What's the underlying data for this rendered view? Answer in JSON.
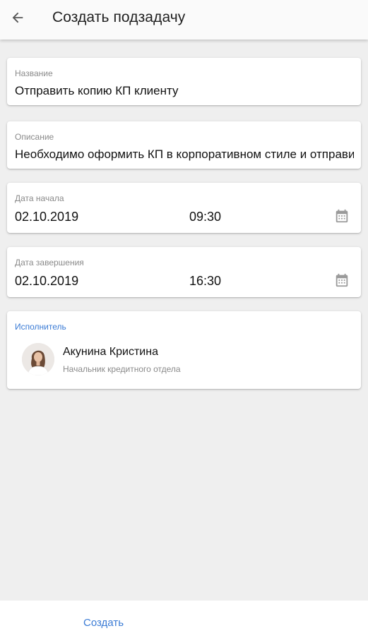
{
  "header": {
    "title": "Создать подзадачу",
    "back_icon": "arrow-left-icon"
  },
  "name_field": {
    "label": "Название",
    "value": "Отправить копию КП клиенту"
  },
  "description_field": {
    "label": "Описание",
    "value": "Необходимо оформить КП в корпоративном стиле и отправить клиенту"
  },
  "start_field": {
    "label": "Дата начала",
    "date": "02.10.2019",
    "time": "09:30",
    "icon": "calendar-icon"
  },
  "end_field": {
    "label": "Дата завершения",
    "date": "02.10.2019",
    "time": "16:30",
    "icon": "calendar-icon"
  },
  "assignee": {
    "label": "Исполнитель",
    "name": "Акунина Кристина",
    "role": "Начальник кредитного отдела"
  },
  "footer": {
    "create_label": "Создать"
  },
  "colors": {
    "accent": "#3a7bd5",
    "background": "#efefef"
  }
}
